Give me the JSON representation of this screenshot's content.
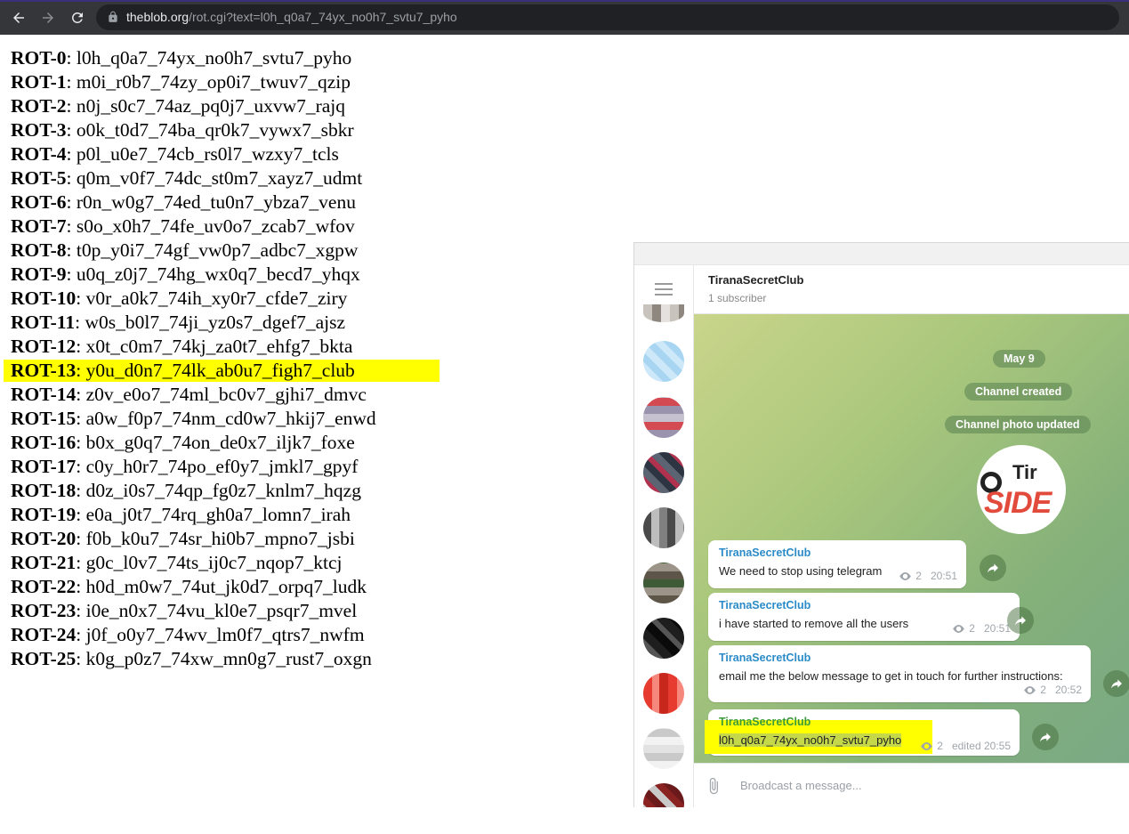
{
  "browser": {
    "url_host": "theblob.org",
    "url_path": "/rot.cgi?text=l0h_q0a7_74yx_no0h7_svtu7_pyho"
  },
  "rot": [
    {
      "label": "ROT-0",
      "value": "l0h_q0a7_74yx_no0h7_svtu7_pyho"
    },
    {
      "label": "ROT-1",
      "value": "m0i_r0b7_74zy_op0i7_twuv7_qzip"
    },
    {
      "label": "ROT-2",
      "value": "n0j_s0c7_74az_pq0j7_uxvw7_rajq"
    },
    {
      "label": "ROT-3",
      "value": "o0k_t0d7_74ba_qr0k7_vywx7_sbkr"
    },
    {
      "label": "ROT-4",
      "value": "p0l_u0e7_74cb_rs0l7_wzxy7_tcls"
    },
    {
      "label": "ROT-5",
      "value": "q0m_v0f7_74dc_st0m7_xayz7_udmt"
    },
    {
      "label": "ROT-6",
      "value": "r0n_w0g7_74ed_tu0n7_ybza7_venu"
    },
    {
      "label": "ROT-7",
      "value": "s0o_x0h7_74fe_uv0o7_zcab7_wfov"
    },
    {
      "label": "ROT-8",
      "value": "t0p_y0i7_74gf_vw0p7_adbc7_xgpw"
    },
    {
      "label": "ROT-9",
      "value": "u0q_z0j7_74hg_wx0q7_becd7_yhqx"
    },
    {
      "label": "ROT-10",
      "value": "v0r_a0k7_74ih_xy0r7_cfde7_ziry"
    },
    {
      "label": "ROT-11",
      "value": "w0s_b0l7_74ji_yz0s7_dgef7_ajsz"
    },
    {
      "label": "ROT-12",
      "value": "x0t_c0m7_74kj_za0t7_ehfg7_bkta"
    },
    {
      "label": "ROT-13",
      "value": "y0u_d0n7_74lk_ab0u7_figh7_club",
      "highlighted": true
    },
    {
      "label": "ROT-14",
      "value": "z0v_e0o7_74ml_bc0v7_gjhi7_dmvc"
    },
    {
      "label": "ROT-15",
      "value": "a0w_f0p7_74nm_cd0w7_hkij7_enwd"
    },
    {
      "label": "ROT-16",
      "value": "b0x_g0q7_74on_de0x7_iljk7_foxe"
    },
    {
      "label": "ROT-17",
      "value": "c0y_h0r7_74po_ef0y7_jmkl7_gpyf"
    },
    {
      "label": "ROT-18",
      "value": "d0z_i0s7_74qp_fg0z7_knlm7_hqzg"
    },
    {
      "label": "ROT-19",
      "value": "e0a_j0t7_74rq_gh0a7_lomn7_irah"
    },
    {
      "label": "ROT-20",
      "value": "f0b_k0u7_74sr_hi0b7_mpno7_jsbi"
    },
    {
      "label": "ROT-21",
      "value": "g0c_l0v7_74ts_ij0c7_nqop7_ktcj"
    },
    {
      "label": "ROT-22",
      "value": "h0d_m0w7_74ut_jk0d7_orpq7_ludk"
    },
    {
      "label": "ROT-23",
      "value": "i0e_n0x7_74vu_kl0e7_psqr7_mvel"
    },
    {
      "label": "ROT-24",
      "value": "j0f_o0y7_74wv_lm0f7_qtrs7_nwfm"
    },
    {
      "label": "ROT-25",
      "value": "k0g_p0z7_74xw_mn0g7_rust7_oxgn"
    }
  ],
  "telegram": {
    "channel_title": "TiranaSecretClub",
    "channel_subtitle": "1 subscriber",
    "service": {
      "date": "May 9",
      "created": "Channel created",
      "photo_updated": "Channel photo updated"
    },
    "photo_text_top": "Tir",
    "photo_text_bottom": "SIDE",
    "messages": [
      {
        "author": "TiranaSecretClub",
        "text": "We need to stop using telegram",
        "views": "2",
        "time": "20:51"
      },
      {
        "author": "TiranaSecretClub",
        "text": "i have started to remove all the users",
        "views": "2",
        "time": "20:51"
      },
      {
        "author": "TiranaSecretClub",
        "text": "email me the below message to get in touch for further instructions:",
        "views": "2",
        "time": "20:52"
      },
      {
        "author": "TiranaSecretClub",
        "text": "l0h_q0a7_74yx_no0h7_svtu7_pyho",
        "views": "2",
        "time": "edited 20:55"
      }
    ],
    "input_placeholder": "Broadcast a message...",
    "colors": {
      "highlight": "#ffff00",
      "author": "#2a8bc8"
    }
  }
}
